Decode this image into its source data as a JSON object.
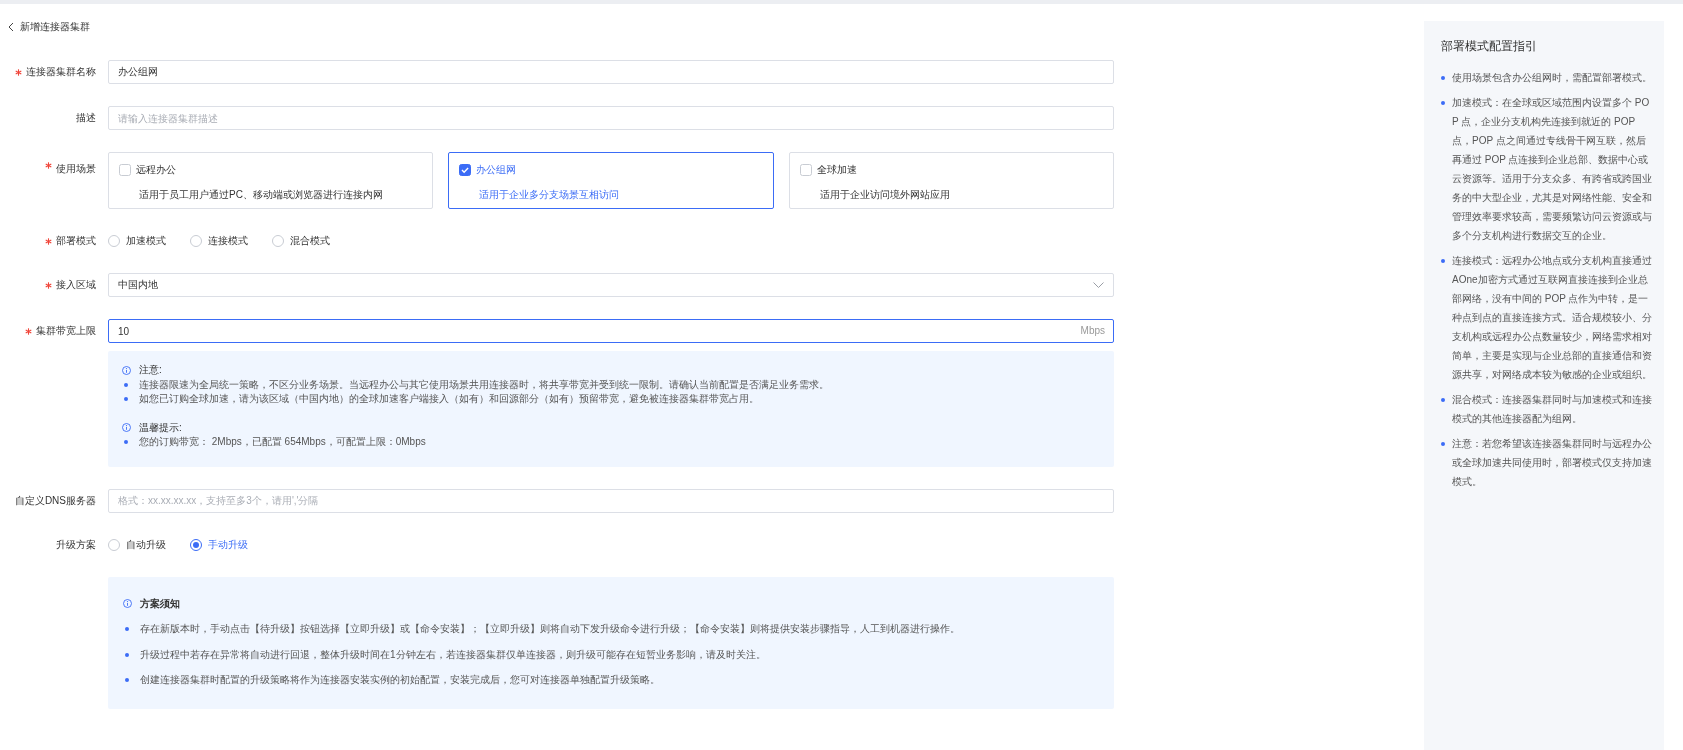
{
  "header": {
    "title": "新增连接器集群"
  },
  "form": {
    "rows": [
      {
        "kind": "input",
        "label": "连接器集群名称",
        "required": true,
        "value": "办公组网"
      },
      {
        "kind": "input",
        "label": "描述",
        "required": false,
        "placeholder": "请输入连接器集群描述"
      },
      {
        "kind": "cards",
        "label": "使用场景",
        "required": true,
        "options": [
          {
            "title": "远程办公",
            "description": "适用于员工用户通过PC、移动端或浏览器进行连接内网",
            "checked": false
          },
          {
            "title": "办公组网",
            "description": "适用于企业多分支场景互相访问",
            "checked": true
          },
          {
            "title": "全球加速",
            "description": "适用于企业访问境外网站应用",
            "checked": false
          }
        ]
      },
      {
        "kind": "radios",
        "label": "部署模式",
        "required": true,
        "options": [
          {
            "label": "加速模式",
            "selected": false
          },
          {
            "label": "连接模式",
            "selected": false
          },
          {
            "label": "混合模式",
            "selected": false
          }
        ]
      },
      {
        "kind": "select",
        "label": "接入区域",
        "required": true,
        "value": "中国内地"
      },
      {
        "kind": "unit_input",
        "label": "集群带宽上限",
        "required": true,
        "value": "10",
        "unit": "Mbps",
        "focused": true
      },
      {
        "kind": "notice",
        "sections": [
          {
            "title": "注意:",
            "items": [
              "连接器限速为全局统一策略，不区分业务场景。当远程办公与其它使用场景共用连接器时，将共享带宽并受到统一限制。请确认当前配置是否满足业务需求。",
              "如您已订购全球加速，请为该区域（中国内地）的全球加速客户端接入（如有）和回源部分（如有）预留带宽，避免被连接器集群带宽占用。"
            ]
          },
          {
            "title": "温馨提示:",
            "items": [
              "您的订购带宽： 2Mbps，已配置 654Mbps，可配置上限：0Mbps"
            ]
          }
        ]
      },
      {
        "kind": "input",
        "label": "自定义DNS服务器",
        "required": false,
        "placeholder": "格式：xx.xx.xx.xx，支持至多3个，请用','分隔"
      },
      {
        "kind": "radios",
        "label": "升级方案",
        "required": false,
        "options": [
          {
            "label": "自动升级",
            "selected": false
          },
          {
            "label": "手动升级",
            "selected": true
          }
        ]
      },
      {
        "kind": "note_list",
        "sections": [
          {
            "title": "方案须知",
            "items": [
              "存在新版本时，手动点击【待升级】按钮选择【立即升级】或【命令安装】；【立即升级】则将自动下发升级命令进行升级；【命令安装】则将提供安装步骤指导，人工到机器进行操作。",
              "升级过程中若存在异常将自动进行回退，整体升级时间在1分钟左右，若连接器集群仅单连接器，则升级可能存在短暂业务影响，请及时关注。",
              "创建连接器集群时配置的升级策略将作为连接器安装实例的初始配置，安装完成后，您可对连接器单独配置升级策略。"
            ]
          }
        ]
      }
    ]
  },
  "guide": {
    "title": "部署模式配置指引",
    "items": [
      "使用场景包含办公组网时，需配置部署模式。",
      "加速模式：在全球或区域范围内设置多个 POP 点，企业分支机构先连接到就近的 POP 点，POP 点之间通过专线骨干网互联，然后再通过 POP 点连接到企业总部、数据中心或云资源等。适用于分支众多、有跨省或跨国业务的中大型企业，尤其是对网络性能、安全和管理效率要求较高，需要频繁访问云资源或与多个分支机构进行数据交互的企业。",
      "连接模式：远程办公地点或分支机构直接通过AOne加密方式通过互联网直接连接到企业总部网络，没有中间的 POP 点作为中转，是一种点到点的直接连接方式。适合规模较小、分支机构或远程办公点数量较少，网络需求相对简单，主要是实现与企业总部的直接通信和资源共享，对网络成本较为敏感的企业或组织。",
      "混合模式：连接器集群同时与加速模式和连接模式的其他连接器配为组网。",
      "注意：若您希望该连接器集群同时与远程办公或全球加速共同使用时，部署模式仅支持加速模式。"
    ]
  }
}
